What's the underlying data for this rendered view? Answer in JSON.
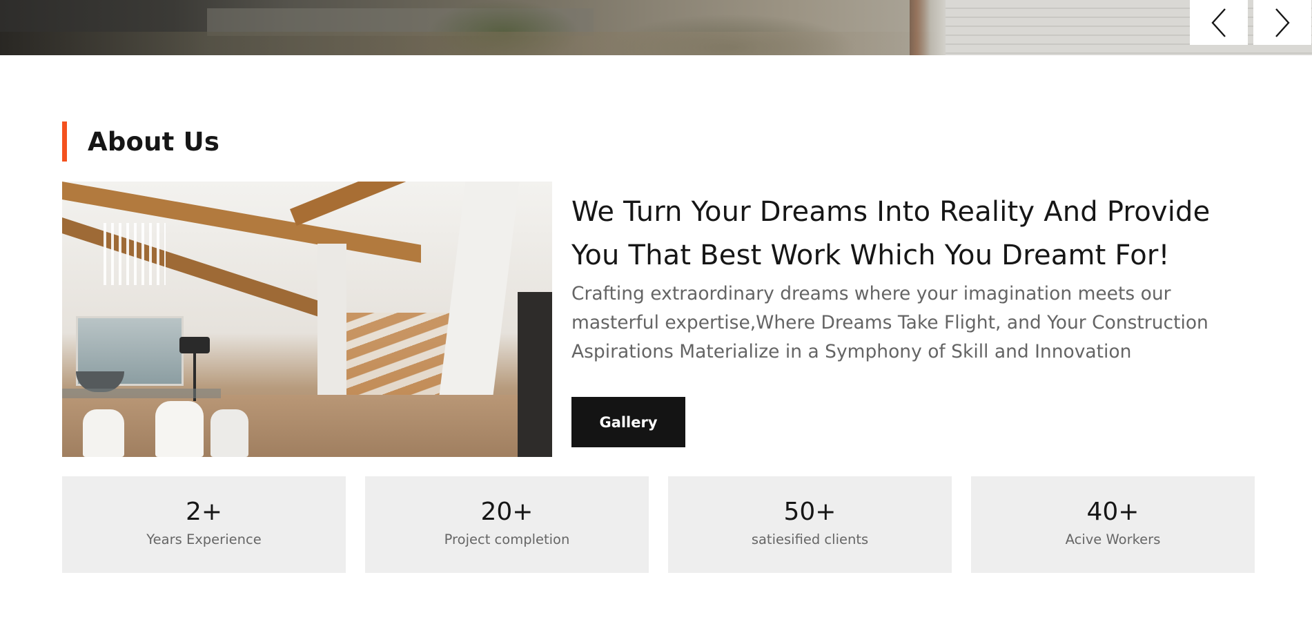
{
  "hero": {
    "prev_icon": "chevron-left-icon",
    "next_icon": "chevron-right-icon"
  },
  "about": {
    "section_title": "About Us",
    "accent_color": "#f4511e",
    "headline": "We Turn Your Dreams Into Reality And Provide You That Best Work Which You Dreamt For!",
    "description": "Crafting extraordinary dreams where your imagination meets our masterful expertise,Where Dreams Take Flight, and Your Construction Aspirations Materialize in a Symphony of Skill and Innovation",
    "gallery_button": "Gallery"
  },
  "stats": [
    {
      "value": "2+",
      "label": "Years Experience"
    },
    {
      "value": "20+",
      "label": "Project completion"
    },
    {
      "value": "50+",
      "label": "satiesified clients"
    },
    {
      "value": "40+",
      "label": "Acive Workers"
    }
  ]
}
